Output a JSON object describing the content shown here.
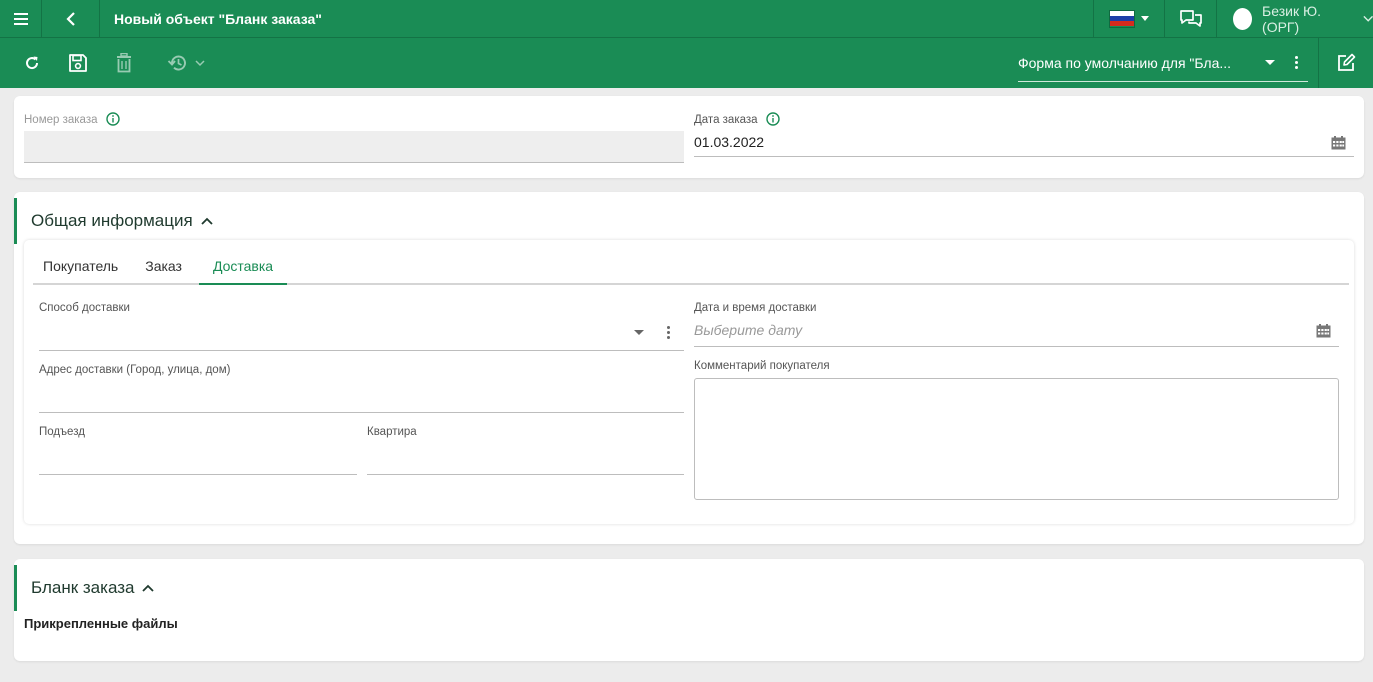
{
  "header": {
    "title": "Новый объект \"Бланк заказа\"",
    "user_name": "Безик Ю. (ОРГ)",
    "flag_colors": [
      "#ffffff",
      "#1c3fa8",
      "#d52b1e"
    ]
  },
  "toolbar": {
    "form_selector_value": "Форма по умолчанию для \"Бла...",
    "icons": [
      "refresh-icon",
      "save-icon",
      "delete-icon",
      "history-icon"
    ]
  },
  "order": {
    "number_label": "Номер заказа",
    "number_value": "",
    "date_label": "Дата заказа",
    "date_value": "01.03.2022"
  },
  "general": {
    "title": "Общая информация",
    "tabs": [
      {
        "label": "Покупатель"
      },
      {
        "label": "Заказ"
      },
      {
        "label": "Доставка"
      }
    ],
    "active_tab": "Доставка",
    "delivery": {
      "method_label": "Способ доставки",
      "method_value": "",
      "address_label": "Адрес доставки (Город, улица, дом)",
      "address_value": "",
      "entrance_label": "Подъезд",
      "entrance_value": "",
      "apartment_label": "Квартира",
      "apartment_value": "",
      "datetime_label": "Дата и время доставки",
      "datetime_placeholder": "Выберите дату",
      "comment_label": "Комментарий покупателя",
      "comment_value": ""
    }
  },
  "blank": {
    "title": "Бланк заказа",
    "attached_files_label": "Прикрепленные файлы"
  },
  "colors": {
    "brand_green": "#1a8c55",
    "info_icon": "#1a8c55"
  }
}
